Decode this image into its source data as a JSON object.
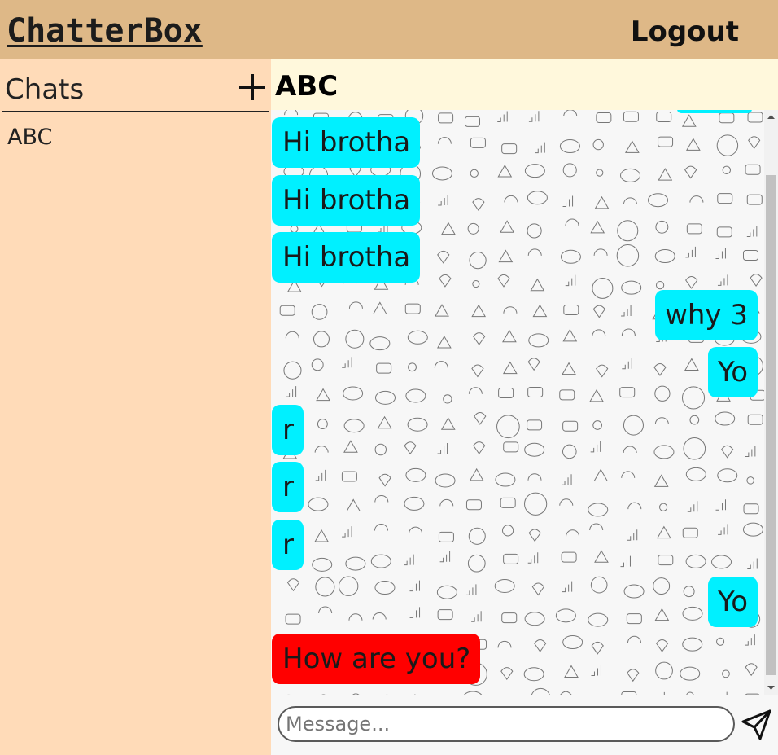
{
  "app": {
    "brand": "ChatterBox",
    "logout_label": "Logout"
  },
  "sidebar": {
    "title": "Chats",
    "add_icon": "plus-icon",
    "chats": [
      {
        "name": "ABC"
      }
    ]
  },
  "conversation": {
    "name": "ABC",
    "messages": [
      {
        "text": "Hi brotha",
        "side": "left"
      },
      {
        "text": "Hi brotha",
        "side": "left"
      },
      {
        "text": "Hi brotha",
        "side": "left"
      },
      {
        "text": "why 3",
        "side": "right"
      },
      {
        "text": "Yo",
        "side": "right"
      },
      {
        "text": "r",
        "side": "left"
      },
      {
        "text": "r",
        "side": "left"
      },
      {
        "text": "r",
        "side": "left"
      },
      {
        "text": "Yo",
        "side": "right"
      },
      {
        "text": "How are you?",
        "side": "left",
        "highlight": true
      }
    ]
  },
  "composer": {
    "placeholder": "Message...",
    "send_icon": "send-icon"
  },
  "colors": {
    "header_bg": "#deb887",
    "sidebar_bg": "#ffdbb8",
    "chat_header_bg": "#fff8dc",
    "bubble_bg": "#00f0ff",
    "bubble_highlight_bg": "#ff0000"
  }
}
